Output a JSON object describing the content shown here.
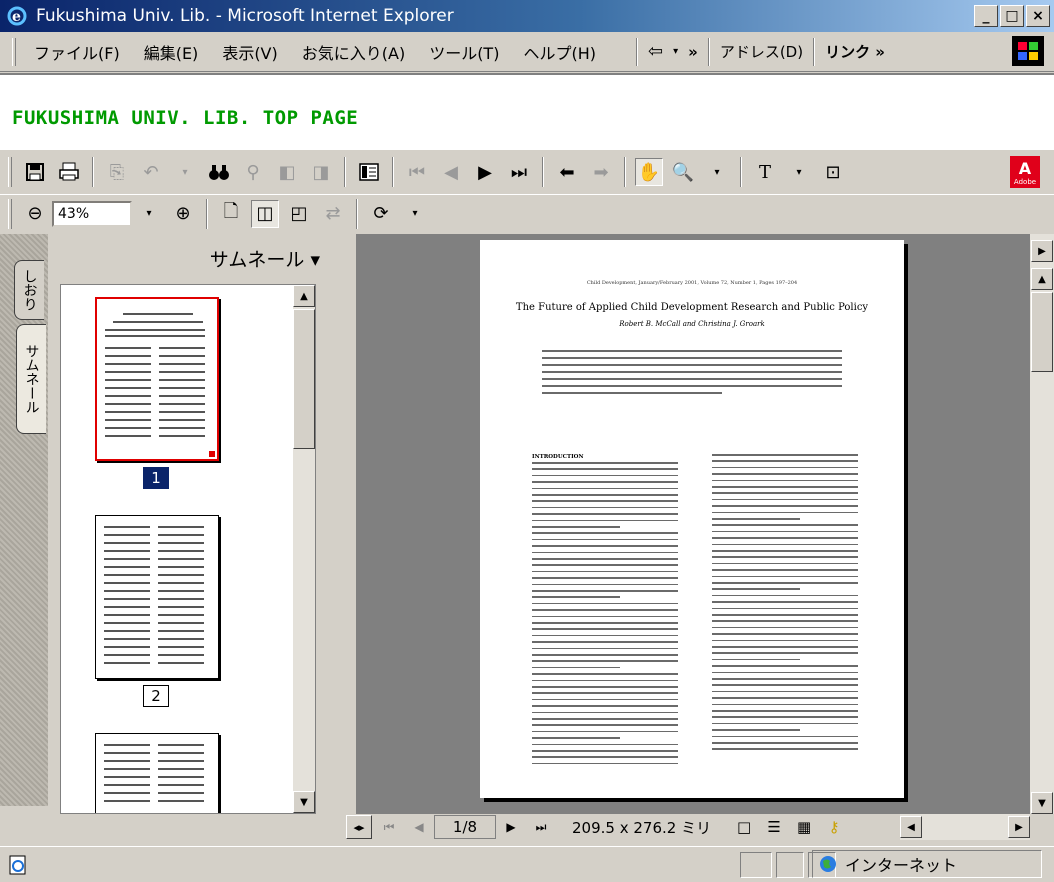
{
  "window": {
    "title": "Fukushima Univ. Lib. - Microsoft Internet Explorer"
  },
  "menu": [
    "ファイル(F)",
    "編集(E)",
    "表示(V)",
    "お気に入り(A)",
    "ツール(T)",
    "ヘルプ(H)"
  ],
  "ie_toolbar": {
    "chevron": "»",
    "address_label": "アドレス(D)",
    "links_label": "リンク »"
  },
  "page": {
    "heading": "FUKUSHIMA UNIV. LIB. TOP PAGE"
  },
  "acrobat": {
    "zoom": "43%",
    "adobe_logo": "Adobe",
    "nav_tabs": {
      "bookmarks": "しおり",
      "thumbnails": "サムネール"
    },
    "thumbnail_header": "サムネール ▾",
    "thumbnails": [
      {
        "label": "1",
        "selected": true
      },
      {
        "label": "2",
        "selected": false
      }
    ],
    "page_indicator": "1/8",
    "page_size": "209.5 x 276.2 ミリ",
    "document": {
      "header": "Child Development, January/February 2001, Volume 72, Number 1, Pages 197–204",
      "title": "The Future of Applied Child Development Research and Public Policy",
      "authors": "Robert B. McCall and Christina J. Groark",
      "section": "INTRODUCTION"
    }
  },
  "status": {
    "zone": "インターネット"
  },
  "colors": {
    "heading": "#009a00",
    "title_bar": "#0a246a",
    "selection": "#0a246a"
  }
}
